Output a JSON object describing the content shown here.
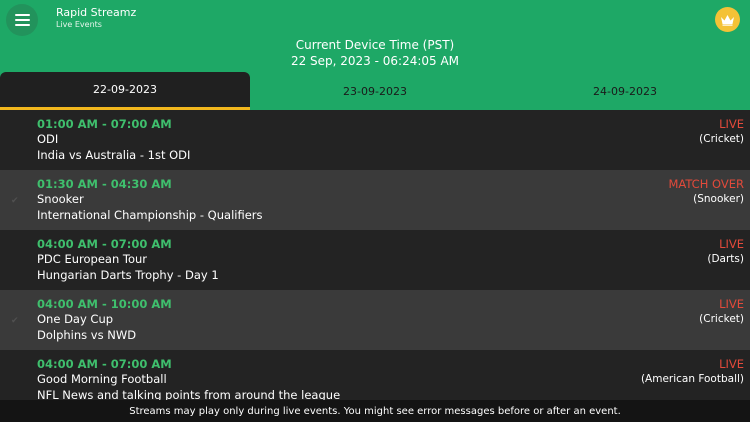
{
  "app": {
    "title": "Rapid Streamz",
    "subtitle": "Live Events"
  },
  "device_time": {
    "label": "Current Device Time (PST)",
    "value": "22 Sep, 2023 - 06:24:05 AM"
  },
  "tabs": [
    {
      "label": "22-09-2023",
      "active": true
    },
    {
      "label": "23-09-2023",
      "active": false
    },
    {
      "label": "24-09-2023",
      "active": false
    }
  ],
  "events": [
    {
      "time": "01:00 AM - 07:00 AM",
      "category": "ODI",
      "match": "India vs Australia - 1st ODI",
      "status": "LIVE",
      "sport": "(Cricket)"
    },
    {
      "time": "01:30 AM - 04:30 AM",
      "category": "Snooker",
      "match": "International Championship - Qualifiers",
      "status": "MATCH OVER",
      "sport": "(Snooker)"
    },
    {
      "time": "04:00 AM - 07:00 AM",
      "category": "PDC European Tour",
      "match": "Hungarian Darts Trophy - Day 1",
      "status": "LIVE",
      "sport": "(Darts)"
    },
    {
      "time": "04:00 AM - 10:00 AM",
      "category": "One Day Cup",
      "match": "Dolphins vs NWD",
      "status": "LIVE",
      "sport": "(Cricket)"
    },
    {
      "time": "04:00 AM - 07:00 AM",
      "category": "Good Morning Football",
      "match": "NFL News and talking points from around the league",
      "status": "LIVE",
      "sport": "(American Football)"
    }
  ],
  "footer": {
    "notice": "Streams may play only during live events. You might see error messages before or after an event."
  },
  "colors": {
    "header_bg": "#1ea866",
    "time_green": "#3fbf6d",
    "status_red": "#e24a3b",
    "tab_indicator": "#f2b71d",
    "crown_bg": "#f4c236"
  }
}
